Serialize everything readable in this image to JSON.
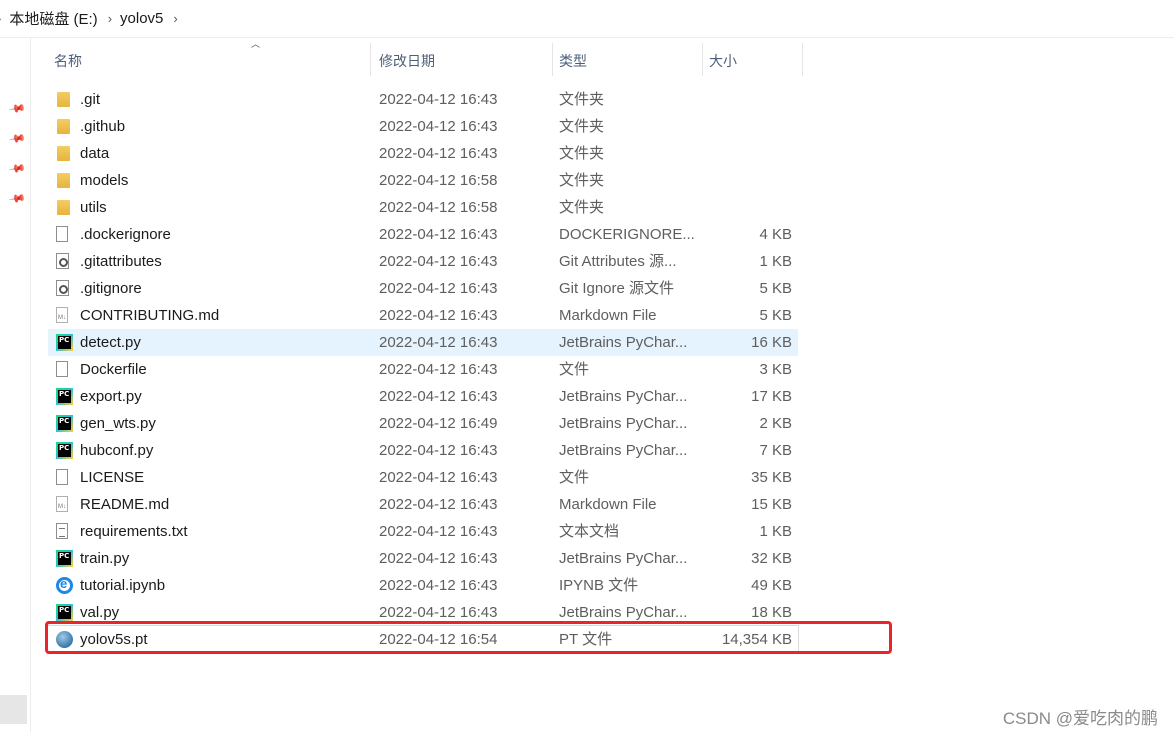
{
  "breadcrumb": {
    "items": [
      "本地磁盘 (E:)",
      "yolov5"
    ]
  },
  "columns": {
    "name": "名称",
    "date": "修改日期",
    "type": "类型",
    "size": "大小"
  },
  "files": [
    {
      "name": ".git",
      "date": "2022-04-12 16:43",
      "type": "文件夹",
      "size": "",
      "icon": "folder-icon"
    },
    {
      "name": ".github",
      "date": "2022-04-12 16:43",
      "type": "文件夹",
      "size": "",
      "icon": "folder-icon"
    },
    {
      "name": "data",
      "date": "2022-04-12 16:43",
      "type": "文件夹",
      "size": "",
      "icon": "folder-icon"
    },
    {
      "name": "models",
      "date": "2022-04-12 16:58",
      "type": "文件夹",
      "size": "",
      "icon": "folder-icon"
    },
    {
      "name": "utils",
      "date": "2022-04-12 16:58",
      "type": "文件夹",
      "size": "",
      "icon": "folder-icon"
    },
    {
      "name": ".dockerignore",
      "date": "2022-04-12 16:43",
      "type": "DOCKERIGNORE...",
      "size": "4 KB",
      "icon": "file-icon"
    },
    {
      "name": ".gitattributes",
      "date": "2022-04-12 16:43",
      "type": "Git Attributes 源...",
      "size": "1 KB",
      "icon": "config-file-icon"
    },
    {
      "name": ".gitignore",
      "date": "2022-04-12 16:43",
      "type": "Git Ignore 源文件",
      "size": "5 KB",
      "icon": "config-file-icon"
    },
    {
      "name": "CONTRIBUTING.md",
      "date": "2022-04-12 16:43",
      "type": "Markdown File",
      "size": "5 KB",
      "icon": "markdown-file-icon"
    },
    {
      "name": "detect.py",
      "date": "2022-04-12 16:43",
      "type": "JetBrains PyChar...",
      "size": "16 KB",
      "icon": "pycharm-file-icon"
    },
    {
      "name": "Dockerfile",
      "date": "2022-04-12 16:43",
      "type": "文件",
      "size": "3 KB",
      "icon": "file-icon"
    },
    {
      "name": "export.py",
      "date": "2022-04-12 16:43",
      "type": "JetBrains PyChar...",
      "size": "17 KB",
      "icon": "pycharm-file-icon"
    },
    {
      "name": "gen_wts.py",
      "date": "2022-04-12 16:49",
      "type": "JetBrains PyChar...",
      "size": "2 KB",
      "icon": "pycharm-file-icon"
    },
    {
      "name": "hubconf.py",
      "date": "2022-04-12 16:43",
      "type": "JetBrains PyChar...",
      "size": "7 KB",
      "icon": "pycharm-file-icon"
    },
    {
      "name": "LICENSE",
      "date": "2022-04-12 16:43",
      "type": "文件",
      "size": "35 KB",
      "icon": "file-icon"
    },
    {
      "name": "README.md",
      "date": "2022-04-12 16:43",
      "type": "Markdown File",
      "size": "15 KB",
      "icon": "markdown-file-icon"
    },
    {
      "name": "requirements.txt",
      "date": "2022-04-12 16:43",
      "type": "文本文档",
      "size": "1 KB",
      "icon": "text-file-icon"
    },
    {
      "name": "train.py",
      "date": "2022-04-12 16:43",
      "type": "JetBrains PyChar...",
      "size": "32 KB",
      "icon": "pycharm-file-icon"
    },
    {
      "name": "tutorial.ipynb",
      "date": "2022-04-12 16:43",
      "type": "IPYNB 文件",
      "size": "49 KB",
      "icon": "ipynb-file-icon"
    },
    {
      "name": "val.py",
      "date": "2022-04-12 16:43",
      "type": "JetBrains PyChar...",
      "size": "18 KB",
      "icon": "pycharm-file-icon"
    },
    {
      "name": "yolov5s.pt",
      "date": "2022-04-12 16:54",
      "type": "PT 文件",
      "size": "14,354 KB",
      "icon": "pt-file-icon"
    }
  ],
  "watermark": "CSDN @爱吃肉的鹏",
  "colors": {
    "highlight": "#e8242c",
    "selected_row": "#e5f3ff"
  }
}
